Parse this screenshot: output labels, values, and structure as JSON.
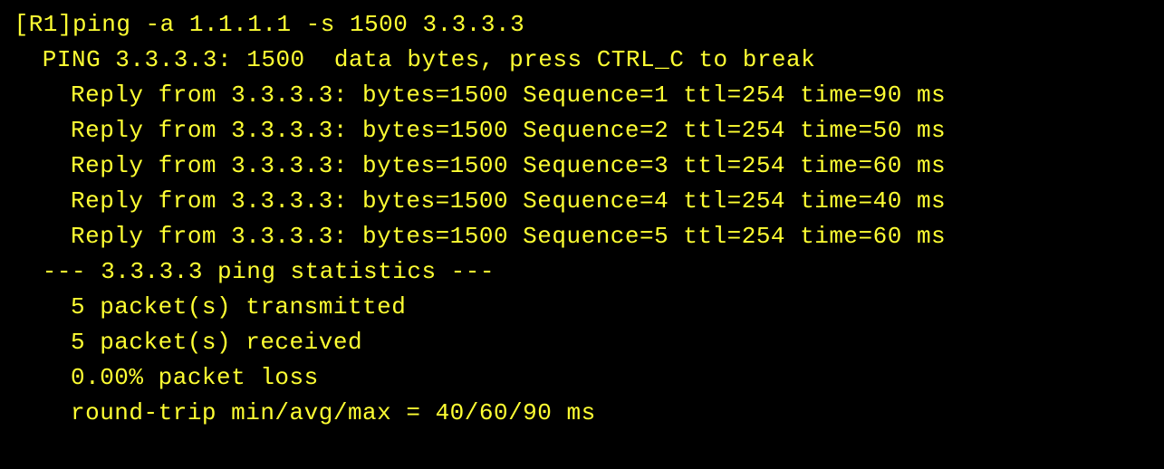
{
  "terminal": {
    "prompt": "[R1]",
    "command": "ping -a 1.1.1.1 -s 1500 3.3.3.3",
    "header": "PING 3.3.3.3: 1500  data bytes, press CTRL_C to break",
    "replies": [
      {
        "from": "3.3.3.3",
        "bytes": 1500,
        "sequence": 1,
        "ttl": 254,
        "time": 90,
        "unit": "ms"
      },
      {
        "from": "3.3.3.3",
        "bytes": 1500,
        "sequence": 2,
        "ttl": 254,
        "time": 50,
        "unit": "ms"
      },
      {
        "from": "3.3.3.3",
        "bytes": 1500,
        "sequence": 3,
        "ttl": 254,
        "time": 60,
        "unit": "ms"
      },
      {
        "from": "3.3.3.3",
        "bytes": 1500,
        "sequence": 4,
        "ttl": 254,
        "time": 40,
        "unit": "ms"
      },
      {
        "from": "3.3.3.3",
        "bytes": 1500,
        "sequence": 5,
        "ttl": 254,
        "time": 60,
        "unit": "ms"
      }
    ],
    "reply_lines": [
      "Reply from 3.3.3.3: bytes=1500 Sequence=1 ttl=254 time=90 ms",
      "Reply from 3.3.3.3: bytes=1500 Sequence=2 ttl=254 time=50 ms",
      "Reply from 3.3.3.3: bytes=1500 Sequence=3 ttl=254 time=60 ms",
      "Reply from 3.3.3.3: bytes=1500 Sequence=4 ttl=254 time=40 ms",
      "Reply from 3.3.3.3: bytes=1500 Sequence=5 ttl=254 time=60 ms"
    ],
    "blank": "",
    "stats_header": "--- 3.3.3.3 ping statistics ---",
    "stats": {
      "transmitted": "5 packet(s) transmitted",
      "received": "5 packet(s) received",
      "loss": "0.00% packet loss",
      "rtt": "round-trip min/avg/max = 40/60/90 ms",
      "packets_tx": 5,
      "packets_rx": 5,
      "loss_pct": 0.0,
      "rtt_min": 40,
      "rtt_avg": 60,
      "rtt_max": 90
    }
  }
}
